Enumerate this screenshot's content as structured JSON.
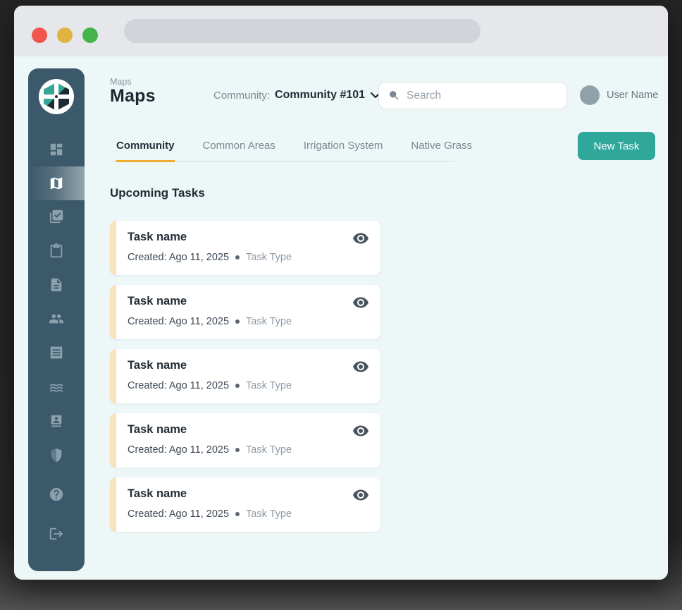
{
  "header": {
    "breadcrumb": "Maps",
    "title": "Maps",
    "community_label": "Community:",
    "community_value": "Community #101",
    "search_placeholder": "Search",
    "user_name": "User Name"
  },
  "tabs": [
    {
      "label": "Community",
      "active": true
    },
    {
      "label": "Common Areas",
      "active": false
    },
    {
      "label": "Irrigation System",
      "active": false
    },
    {
      "label": "Native Grass",
      "active": false
    }
  ],
  "toolbar": {
    "new_task_label": "New Task"
  },
  "content": {
    "section_title": "Upcoming Tasks",
    "tasks": [
      {
        "name": "Task name",
        "created": "Created: Ago 11, 2025",
        "type": "Task Type"
      },
      {
        "name": "Task name",
        "created": "Created: Ago 11, 2025",
        "type": "Task Type"
      },
      {
        "name": "Task name",
        "created": "Created: Ago 11, 2025",
        "type": "Task Type"
      },
      {
        "name": "Task name",
        "created": "Created: Ago 11, 2025",
        "type": "Task Type"
      },
      {
        "name": "Task name",
        "created": "Created: Ago 11, 2025",
        "type": "Task Type"
      }
    ]
  },
  "sidebar": {
    "icons": [
      "dashboard",
      "maps",
      "tasks-check",
      "clipboard",
      "documents",
      "people",
      "receipts",
      "waves",
      "contacts",
      "shield",
      "help",
      "logout"
    ],
    "active_icon": "maps"
  },
  "colors": {
    "sidebar_bg": "#3b596a",
    "accent_teal": "#2fa79b",
    "tab_underline_orange": "#f0ab2f",
    "card_stripe_peach": "#f8e3bd",
    "content_bg": "#eef7f7",
    "traffic_red": "#f2554d",
    "traffic_yellow": "#e0b343",
    "traffic_green": "#43b54a"
  }
}
